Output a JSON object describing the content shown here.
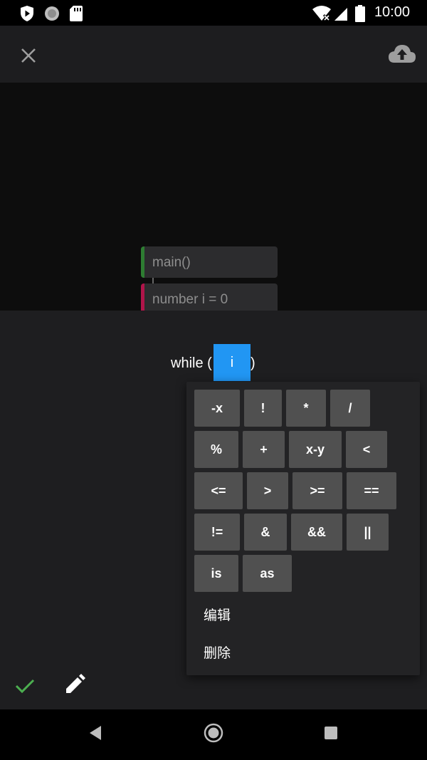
{
  "status_bar": {
    "time": "10:00",
    "icons": [
      "shield-play-icon",
      "app-circle-icon",
      "sd-card-icon",
      "wifi-off-icon",
      "signal-icon",
      "battery-icon"
    ]
  },
  "toolbar": {
    "close_icon": "close-icon",
    "upload_icon": "cloud-upload-icon"
  },
  "canvas": {
    "blocks": [
      {
        "label": "main()",
        "color": "#2e7d32"
      },
      {
        "label": "number i = 0",
        "color": "#b0154a"
      }
    ]
  },
  "editor": {
    "keyword": "while (",
    "selected_slot": "i",
    "close_paren": ")",
    "slot_color": "#2196f3"
  },
  "operators": [
    [
      "-x",
      "!",
      "*",
      "/"
    ],
    [
      "%",
      "+",
      "x-y",
      "<"
    ],
    [
      "<=",
      ">",
      ">=",
      "=="
    ],
    [
      "!=",
      "&",
      "&&",
      "||"
    ],
    [
      "is",
      "as"
    ]
  ],
  "menu": {
    "edit_label": "编辑",
    "delete_label": "删除"
  },
  "actions": {
    "confirm_icon": "check-icon",
    "confirm_color": "#4caf50",
    "edit_icon": "pencil-icon"
  },
  "nav": {
    "back_icon": "back-triangle-icon",
    "home_icon": "home-circle-icon",
    "recent_icon": "recent-square-icon"
  }
}
